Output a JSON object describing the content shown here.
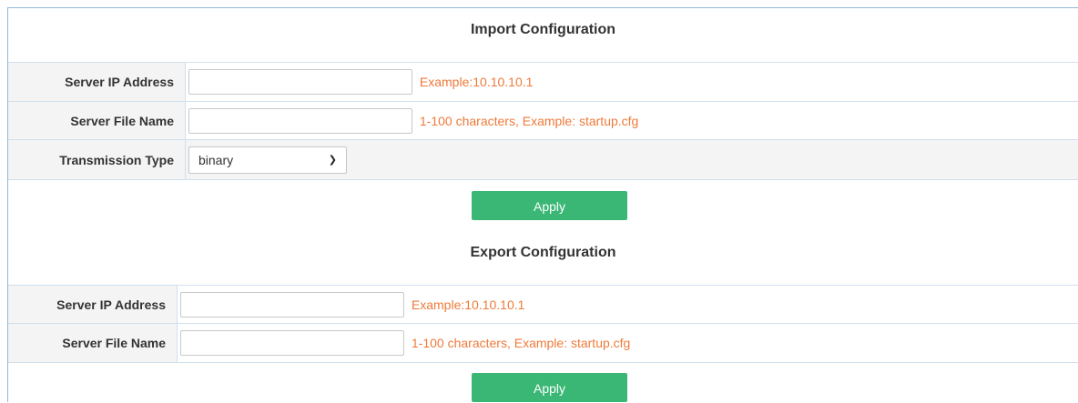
{
  "import": {
    "title": "Import Configuration",
    "server_ip_label": "Server IP Address",
    "server_ip_value": "",
    "server_ip_hint": "Example:10.10.10.1",
    "file_name_label": "Server File Name",
    "file_name_value": "",
    "file_name_hint": "1-100 characters, Example: startup.cfg",
    "transmission_label": "Transmission Type",
    "transmission_value": "binary",
    "apply_label": "Apply"
  },
  "export": {
    "title": "Export Configuration",
    "server_ip_label": "Server IP Address",
    "server_ip_value": "",
    "server_ip_hint": "Example:10.10.10.1",
    "file_name_label": "Server File Name",
    "file_name_value": "",
    "file_name_hint": "1-100 characters, Example: startup.cfg",
    "apply_label": "Apply"
  },
  "colors": {
    "accent_button": "#3bb775",
    "hint_text": "#ee7a3a",
    "border": "#cfe0ee"
  }
}
